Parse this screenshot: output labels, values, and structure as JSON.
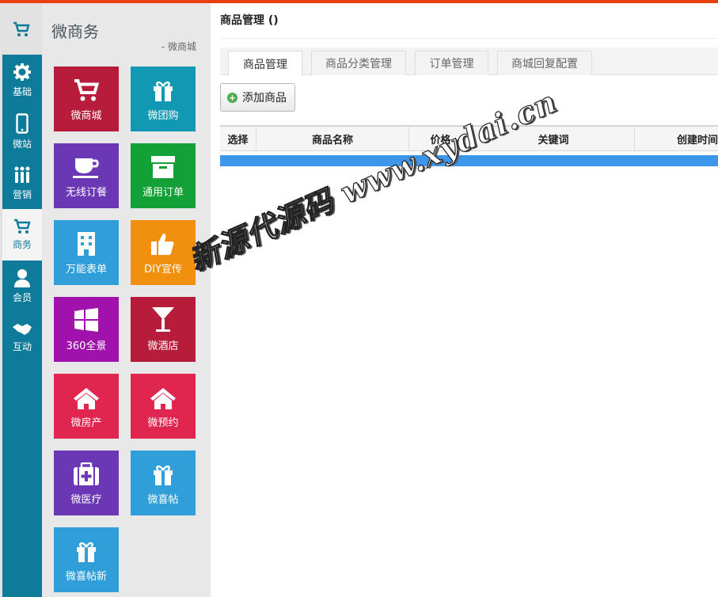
{
  "app": {
    "title": "微商务",
    "subtitle": "- 微商城",
    "cart_icon": "cart-icon"
  },
  "rail": {
    "items": [
      {
        "label": "基础",
        "icon": "gear-icon",
        "active": false
      },
      {
        "label": "微站",
        "icon": "phone-icon",
        "active": false
      },
      {
        "label": "营销",
        "icon": "people-icon",
        "active": false
      },
      {
        "label": "商务",
        "icon": "cart-icon",
        "active": true
      },
      {
        "label": "会员",
        "icon": "user-icon",
        "active": false
      },
      {
        "label": "互动",
        "icon": "handshake-icon",
        "active": false
      }
    ]
  },
  "tiles": [
    {
      "label": "微商城",
      "icon": "cart-icon",
      "color": "#b71c3a"
    },
    {
      "label": "微团购",
      "icon": "gift-icon",
      "color": "#1198b3"
    },
    {
      "label": "无线订餐",
      "icon": "cup-icon",
      "color": "#6b37b5"
    },
    {
      "label": "通用订单",
      "icon": "archive-icon",
      "color": "#13a036"
    },
    {
      "label": "万能表单",
      "icon": "building-icon",
      "color": "#2f9ed9"
    },
    {
      "label": "DIY宣传",
      "icon": "thumbs-up-icon",
      "color": "#f0900e"
    },
    {
      "label": "360全景",
      "icon": "windows-icon",
      "color": "#a012ab"
    },
    {
      "label": "微酒店",
      "icon": "cocktail-icon",
      "color": "#b71c3a"
    },
    {
      "label": "微房产",
      "icon": "home-icon",
      "color": "#e0254f"
    },
    {
      "label": "微预约",
      "icon": "home-icon",
      "color": "#e0254f"
    },
    {
      "label": "微医疗",
      "icon": "medkit-icon",
      "color": "#6b37b5"
    },
    {
      "label": "微喜帖",
      "icon": "gift-icon",
      "color": "#2f9ed9"
    },
    {
      "label": "微喜帖新",
      "icon": "gift-icon",
      "color": "#2f9ed9"
    }
  ],
  "main": {
    "title": "商品管理 ()",
    "tabs": [
      {
        "label": "商品管理",
        "active": true
      },
      {
        "label": "商品分类管理",
        "active": false
      },
      {
        "label": "订单管理",
        "active": false
      },
      {
        "label": "商城回复配置",
        "active": false
      }
    ],
    "add_button": "添加商品",
    "table": {
      "columns": [
        "选择",
        "商品名称",
        "价格",
        "关键词",
        "创建时间"
      ]
    }
  },
  "watermark": "新源代源码  www.xydai.cn",
  "colors": {
    "accent_top": "#e8410f",
    "rail": "#0f7b9a",
    "table_bar": "#3d96ea"
  }
}
